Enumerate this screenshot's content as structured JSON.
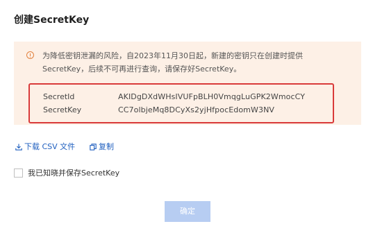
{
  "dialog": {
    "title": "创建SecretKey"
  },
  "notice": {
    "icon": "warning-circle-icon",
    "text": "为降低密钥泄漏的风险，自2023年11月30日起，新建的密钥只在创建时提供SecretKey，后续不可再进行查询，请保存好SecretKey。",
    "accent_color": "#e2803d",
    "background_color": "#fdf0e6"
  },
  "credentials": {
    "highlight_color": "#d93a3a",
    "secret_id_label": "SecretId",
    "secret_id_value": "AKIDgDXdWHsIVUFpBLH0VmqgLuGPK2WmocCY",
    "secret_key_label": "SecretKey",
    "secret_key_value": "CC7olbjeMq8DCyXs2yjHfpocEdomW3NV"
  },
  "actions": {
    "download_icon": "download-icon",
    "download_label": "下载 CSV 文件",
    "copy_icon": "copy-icon",
    "copy_label": "复制",
    "link_color": "#1f5fbf"
  },
  "acknowledge": {
    "checked": false,
    "label": "我已知晓并保存SecretKey"
  },
  "footer": {
    "confirm_label": "确定",
    "confirm_disabled": true,
    "confirm_color": "#b7cdf2"
  }
}
